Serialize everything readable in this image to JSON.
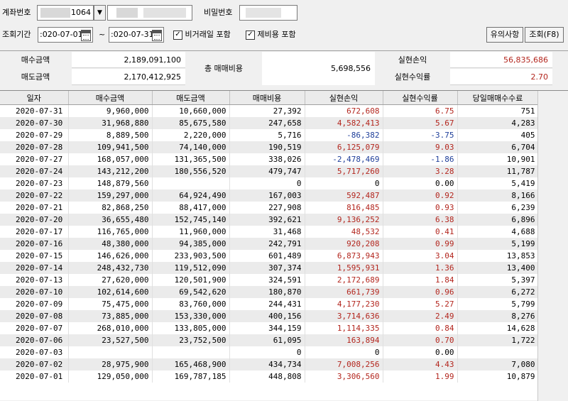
{
  "search": {
    "account_label": "계좌번호",
    "account_suffix": "1064",
    "dropdown_glyph": "▼",
    "password_label": "비밀번호",
    "period_label": "조회기간",
    "date_from": ":020-07-01",
    "date_to": ":020-07-31",
    "tilde": "~",
    "checkbox1_label": "비거래일 포함",
    "checkbox2_label": "제비용 포함",
    "notice_button": "유의사항",
    "query_button": "조회(F8)"
  },
  "summary": {
    "buy_label": "매수금액",
    "buy_value": "2,189,091,100",
    "sell_label": "매도금액",
    "sell_value": "2,170,412,925",
    "total_fee_label": "총 매매비용",
    "total_fee_value": "5,698,556",
    "realized_label": "실현손익",
    "realized_value": "56,835,686",
    "realized_rate_label": "실현수익률",
    "realized_rate_value": "2.70"
  },
  "colors": {
    "profit": "#b3261e",
    "loss": "#1f3f9a"
  },
  "table": {
    "columns": [
      "일자",
      "매수금액",
      "매도금액",
      "매매비용",
      "실현손익",
      "실현수익률",
      "당일매매수수료"
    ],
    "rows": [
      [
        "2020-07-31",
        "9,960,000",
        "10,660,000",
        "27,392",
        "672,608",
        "6.75",
        "751"
      ],
      [
        "2020-07-30",
        "31,968,880",
        "85,675,580",
        "247,658",
        "4,582,413",
        "5.67",
        "4,283"
      ],
      [
        "2020-07-29",
        "8,889,500",
        "2,220,000",
        "5,716",
        "-86,382",
        "-3.75",
        "405"
      ],
      [
        "2020-07-28",
        "109,941,500",
        "74,140,000",
        "190,519",
        "6,125,079",
        "9.03",
        "6,704"
      ],
      [
        "2020-07-27",
        "168,057,000",
        "131,365,500",
        "338,026",
        "-2,478,469",
        "-1.86",
        "10,901"
      ],
      [
        "2020-07-24",
        "143,212,200",
        "180,556,520",
        "479,747",
        "5,717,260",
        "3.28",
        "11,787"
      ],
      [
        "2020-07-23",
        "148,879,560",
        "",
        "0",
        "0",
        "0.00",
        "5,419"
      ],
      [
        "2020-07-22",
        "159,297,000",
        "64,924,490",
        "167,003",
        "592,487",
        "0.92",
        "8,166"
      ],
      [
        "2020-07-21",
        "82,868,250",
        "88,417,000",
        "227,908",
        "816,485",
        "0.93",
        "6,239"
      ],
      [
        "2020-07-20",
        "36,655,480",
        "152,745,140",
        "392,621",
        "9,136,252",
        "6.38",
        "6,896"
      ],
      [
        "2020-07-17",
        "116,765,000",
        "11,960,000",
        "31,468",
        "48,532",
        "0.41",
        "4,688"
      ],
      [
        "2020-07-16",
        "48,380,000",
        "94,385,000",
        "242,791",
        "920,208",
        "0.99",
        "5,199"
      ],
      [
        "2020-07-15",
        "146,626,000",
        "233,903,500",
        "601,489",
        "6,873,943",
        "3.04",
        "13,853"
      ],
      [
        "2020-07-14",
        "248,432,730",
        "119,512,090",
        "307,374",
        "1,595,931",
        "1.36",
        "13,400"
      ],
      [
        "2020-07-13",
        "27,620,000",
        "120,501,900",
        "324,591",
        "2,172,689",
        "1.84",
        "5,397"
      ],
      [
        "2020-07-10",
        "102,614,600",
        "69,542,620",
        "180,870",
        "661,739",
        "0.96",
        "6,272"
      ],
      [
        "2020-07-09",
        "75,475,000",
        "83,760,000",
        "244,431",
        "4,177,230",
        "5.27",
        "5,799"
      ],
      [
        "2020-07-08",
        "73,885,000",
        "153,330,000",
        "400,156",
        "3,714,636",
        "2.49",
        "8,276"
      ],
      [
        "2020-07-07",
        "268,010,000",
        "133,805,000",
        "344,159",
        "1,114,335",
        "0.84",
        "14,628"
      ],
      [
        "2020-07-06",
        "23,527,500",
        "23,752,500",
        "61,095",
        "163,894",
        "0.70",
        "1,722"
      ],
      [
        "2020-07-03",
        "",
        "",
        "0",
        "0",
        "0.00",
        ""
      ],
      [
        "2020-07-02",
        "28,975,900",
        "165,468,900",
        "434,734",
        "7,008,256",
        "4.43",
        "7,080"
      ],
      [
        "2020-07-01",
        "129,050,000",
        "169,787,185",
        "448,808",
        "3,306,560",
        "1.99",
        "10,879"
      ]
    ]
  }
}
